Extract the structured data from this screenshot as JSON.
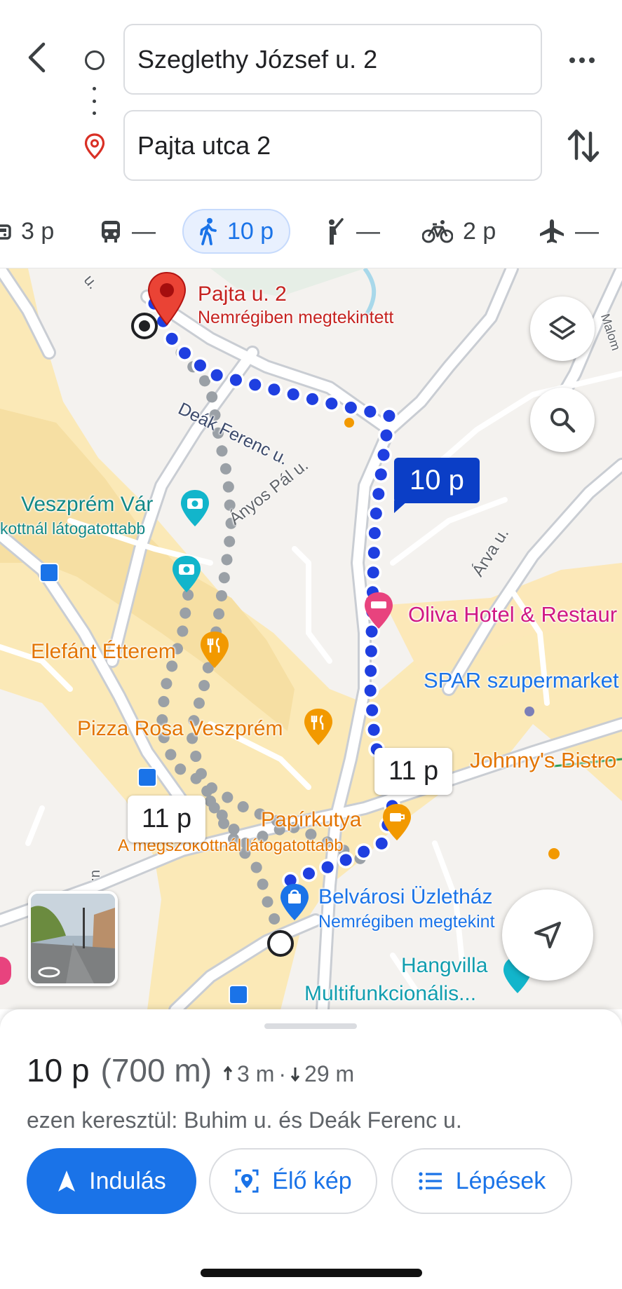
{
  "search": {
    "origin_value": "Szeglethy József u. 2",
    "destination_value": "Pajta utca 2"
  },
  "modes": [
    {
      "icon": "car-icon",
      "label": "3 p"
    },
    {
      "icon": "transit-icon",
      "label": "—"
    },
    {
      "icon": "walk-icon",
      "label": "10 p",
      "active": true
    },
    {
      "icon": "ride-hail-icon",
      "label": "—"
    },
    {
      "icon": "bike-icon",
      "label": "2 p"
    },
    {
      "icon": "flight-icon",
      "label": "—"
    }
  ],
  "map": {
    "dest_marker": {
      "title": "Pajta u. 2",
      "subtitle": "Nemrégiben megtekintett"
    },
    "streets": {
      "deak": "Deák Ferenc u.",
      "anyos": "Ányos Pál u.",
      "arva": "Árva u.",
      "malom": "Malom",
      "u_top": "u.",
      "u_left": "u."
    },
    "pois": {
      "var": "Veszprém Vár",
      "var_sub": "kottnál látogatottabb",
      "hotel": "Oliva Hotel & Restaur",
      "spar": "SPAR szupermarket",
      "elefant": "Elefánt Étterem",
      "pizza": "Pizza Rosa Veszprém",
      "johnnys": "Johnny's Bistro",
      "papirkutya": "Papírkutya",
      "papirkutya_sub": "A megszokottnál látogatottabb",
      "belvarosi": "Belvárosi Üzletház",
      "belvarosi_sub": "Nemrégiben megtekint",
      "hangvilla": "Hangvilla",
      "hangvilla_sub": "Multifunkcionális..."
    },
    "route_badges": {
      "selected": "10 p",
      "alt_right": "11 p",
      "alt_left": "11 p"
    },
    "colors": {
      "route": "#1f3fe0",
      "alt_route": "#b8bcc4",
      "accent": "#1a73e8",
      "pin": "#e53935"
    }
  },
  "summary": {
    "time": "10 p",
    "distance": "(700 m)",
    "ascent": "3 m",
    "separator": "·",
    "descent": "29 m",
    "via": "ezen keresztül: Buhim u. és Deák Ferenc u."
  },
  "actions": {
    "start": "Indulás",
    "live_view": "Élő kép",
    "steps": "Lépések"
  }
}
